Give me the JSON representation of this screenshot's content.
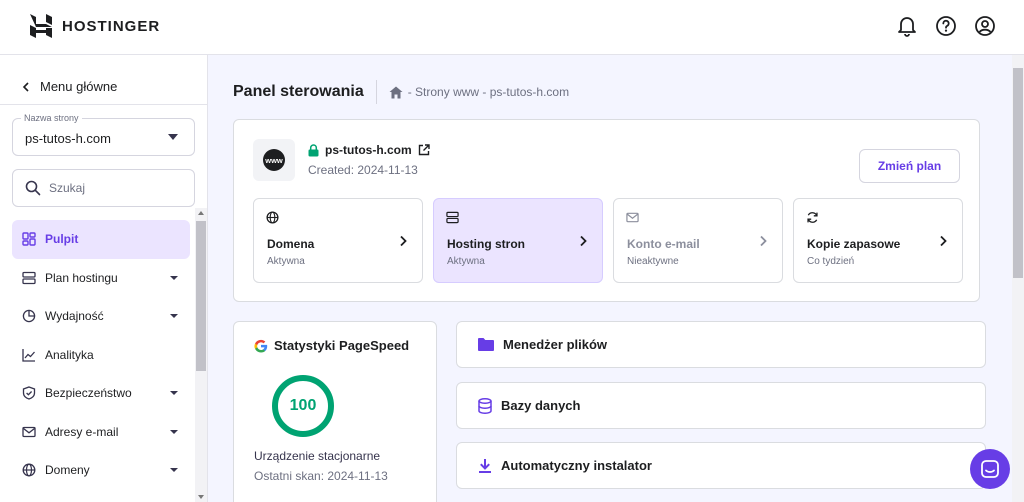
{
  "brand": {
    "name": "HOSTINGER"
  },
  "colors": {
    "accent": "#673de6",
    "success": "#00a372",
    "active_bg": "#ebe4ff"
  },
  "topbar": {
    "icons": [
      "bell-icon",
      "help-icon",
      "account-icon"
    ]
  },
  "sidebar": {
    "back_label": "Menu główne",
    "site_select": {
      "label": "Nazwa strony",
      "value": "ps-tutos-h.com"
    },
    "search": {
      "placeholder": "Szukaj"
    },
    "items": [
      {
        "label": "Pulpit",
        "icon": "dashboard-icon",
        "active": true,
        "expandable": false
      },
      {
        "label": "Plan hostingu",
        "icon": "server-icon",
        "active": false,
        "expandable": true
      },
      {
        "label": "Wydajność",
        "icon": "pie-chart-icon",
        "active": false,
        "expandable": true
      },
      {
        "label": "Analityka",
        "icon": "analytics-icon",
        "active": false,
        "expandable": false
      },
      {
        "label": "Bezpieczeństwo",
        "icon": "shield-icon",
        "active": false,
        "expandable": true
      },
      {
        "label": "Adresy e-mail",
        "icon": "mail-icon",
        "active": false,
        "expandable": true
      },
      {
        "label": "Domeny",
        "icon": "globe-icon",
        "active": false,
        "expandable": true
      }
    ]
  },
  "main": {
    "title": "Panel sterowania",
    "breadcrumb": "- Strony www - ps-tutos-h.com",
    "site": {
      "avatar_text": "www",
      "name": "ps-tutos-h.com",
      "created": "Created: 2024-11-13",
      "change_plan_label": "Zmień plan"
    },
    "tiles": [
      {
        "title": "Domena",
        "status": "Aktywna",
        "icon": "globe-icon",
        "active": false,
        "dim": false
      },
      {
        "title": "Hosting stron",
        "status": "Aktywna",
        "icon": "server-icon",
        "active": true,
        "dim": false
      },
      {
        "title": "Konto e-mail",
        "status": "Nieaktywne",
        "icon": "mail-icon",
        "active": false,
        "dim": true
      },
      {
        "title": "Kopie zapasowe",
        "status": "Co tydzień",
        "icon": "refresh-icon",
        "active": false,
        "dim": false
      }
    ],
    "pagespeed": {
      "title": "Statystyki PageSpeed",
      "score": "100",
      "device": "Urządzenie stacjonarne",
      "last_scan": "Ostatni skan: 2024-11-13"
    },
    "actions": [
      {
        "label": "Menedżer plików",
        "icon": "folder-icon"
      },
      {
        "label": "Bazy danych",
        "icon": "database-icon"
      },
      {
        "label": "Automatyczny instalator",
        "icon": "download-icon"
      }
    ]
  }
}
